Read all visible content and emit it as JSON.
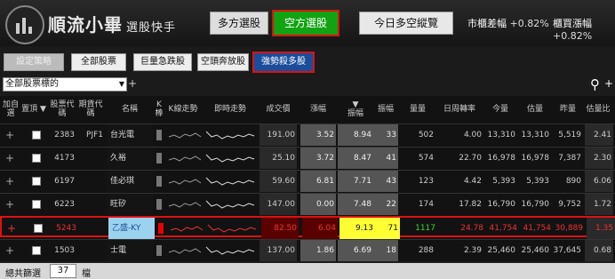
{
  "header": {
    "brand": "順流小畢",
    "brand_sub": "選股快手",
    "btn_long": "多方選股",
    "btn_short": "空方選股",
    "btn_overview": "今日多空縱覽",
    "market_label": "市櫃差幅",
    "market_value": "+0.82%",
    "otc_label": "櫃買漲幅",
    "otc_value": "+0.82%"
  },
  "toolbar": {
    "strategy": "設定策略",
    "all": "全部股票",
    "volume": "巨量急跌股",
    "breakdown": "空頭奔放股",
    "strong": "強勢殺多股"
  },
  "filter": {
    "select_value": "全部股票標的",
    "add": "+",
    "search_add": "+"
  },
  "table": {
    "headers": {
      "add": "加自選",
      "pin": "置頂 ▼",
      "code": "股票代碼",
      "fut": "期貨代碼",
      "name": "名稱",
      "k": "K棒",
      "kline": "K線走勢",
      "intraday": "即時走勢",
      "price": "成交價",
      "chg": "漲幅",
      "amp_sort": "▼",
      "amp": "振幅",
      "amp2": "振幅",
      "vol": "量量",
      "turn": "日周轉率",
      "today_vol": "今量",
      "est_vol": "估量",
      "y_vol": "昨量",
      "est_ratio": "估量比"
    },
    "rows": [
      {
        "plus": "+",
        "code": "2383",
        "fut": "PJF1",
        "name": "台光電",
        "price": "191.00",
        "chg": "3.52",
        "amp": "8.94",
        "amp2": "33",
        "vol": "502",
        "turn": "4.00",
        "tv": "13,310",
        "ev": "13,310",
        "yv": "5,519",
        "ratio": "2.41"
      },
      {
        "plus": "+",
        "code": "4173",
        "fut": "",
        "name": "久裕",
        "price": "25.10",
        "chg": "3.72",
        "amp": "8.47",
        "amp2": "41",
        "vol": "574",
        "turn": "22.70",
        "tv": "16,978",
        "ev": "16,978",
        "yv": "7,387",
        "ratio": "2.30"
      },
      {
        "plus": "+",
        "code": "6197",
        "fut": "",
        "name": "佳必琪",
        "price": "59.60",
        "chg": "6.81",
        "amp": "7.71",
        "amp2": "43",
        "vol": "123",
        "turn": "4.42",
        "tv": "5,393",
        "ev": "5,393",
        "yv": "890",
        "ratio": "6.06"
      },
      {
        "plus": "+",
        "code": "6223",
        "fut": "",
        "name": "旺矽",
        "price": "147.00",
        "chg": "0.00",
        "amp": "7.48",
        "amp2": "22",
        "vol": "174",
        "turn": "17.82",
        "tv": "16,790",
        "ev": "16,790",
        "yv": "9,752",
        "ratio": "1.72"
      },
      {
        "plus": "+",
        "code": "5243",
        "fut": "",
        "name": "乙盛-KY",
        "price": "82.50",
        "chg": "6.04",
        "amp": "9.13",
        "amp2": "71",
        "vol": "1117",
        "turn": "24.78",
        "tv": "41,754",
        "ev": "41,754",
        "yv": "30,889",
        "ratio": "1.35"
      },
      {
        "plus": "+",
        "code": "1503",
        "fut": "",
        "name": "士電",
        "price": "137.00",
        "chg": "1.86",
        "amp": "6.69",
        "amp2": "18",
        "vol": "288",
        "turn": "2.39",
        "tv": "25,460",
        "ev": "25,460",
        "yv": "37,645",
        "ratio": "0.68"
      }
    ]
  },
  "status": {
    "label": "總共篩選",
    "count": "37",
    "unit": "檔"
  },
  "colors": {
    "accent_green": "#12a312",
    "highlight_red": "#d11",
    "select_blue": "#1a4d9b",
    "yellow": "#ffff33"
  }
}
